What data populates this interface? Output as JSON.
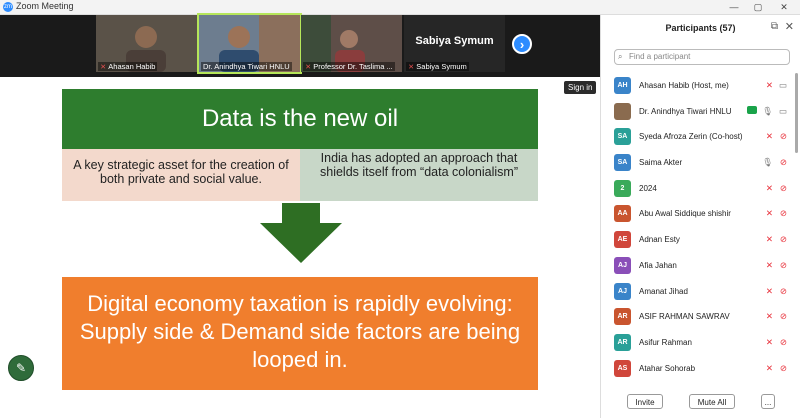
{
  "window": {
    "title": "Zoom Meeting",
    "sign_in": "Sign in"
  },
  "videos": [
    {
      "name": "Ahasan Habib"
    },
    {
      "name": "Dr. Anindhya Tiwari HNLU"
    },
    {
      "name": "Professor Dr. Taslima ..."
    },
    {
      "name": "Sabiya Symum",
      "big_name": "Sabiya Symum"
    }
  ],
  "slide": {
    "title": "Data is the new oil",
    "left_box": "A key strategic asset for the creation of both private and social value.",
    "right_box": "India has adopted an approach that shields itself from “data colonialism”",
    "bottom": "Digital economy taxation is rapidly evolving: Supply side & Demand side factors are being looped in."
  },
  "participants": {
    "title": "Participants (57)",
    "search_placeholder": "Find a participant",
    "items": [
      {
        "initials": "AH",
        "name": "Ahasan Habib (Host, me)",
        "color": "#3a84c9"
      },
      {
        "initials": "",
        "name": "Dr. Anindhya Tiwari HNLU",
        "color": "#8a6b4f"
      },
      {
        "initials": "SA",
        "name": "Syeda Afroza Zerin (Co-host)",
        "color": "#2aa098"
      },
      {
        "initials": "SA",
        "name": "Saima Akter",
        "color": "#3a84c9"
      },
      {
        "initials": "2",
        "name": "2024",
        "color": "#3aaa5a"
      },
      {
        "initials": "AA",
        "name": "Abu Awal Siddique shishir",
        "color": "#c9552f"
      },
      {
        "initials": "AE",
        "name": "Adnan Esty",
        "color": "#d0463b"
      },
      {
        "initials": "AJ",
        "name": "Afia Jahan",
        "color": "#8a4fb8"
      },
      {
        "initials": "AJ",
        "name": "Amanat Jihad",
        "color": "#3a84c9"
      },
      {
        "initials": "AR",
        "name": "ASIF RAHMAN SAWRAV",
        "color": "#c9552f"
      },
      {
        "initials": "AR",
        "name": "Asifur Rahman",
        "color": "#2aa098"
      },
      {
        "initials": "AS",
        "name": "Atahar Sohorab",
        "color": "#d0463b"
      }
    ],
    "invite": "Invite",
    "mute_all": "Mute All",
    "more": "..."
  },
  "colors": {
    "slide_green": "#2e7d2e",
    "slide_orange": "#f07e2d",
    "accent": "#2d8cff"
  }
}
